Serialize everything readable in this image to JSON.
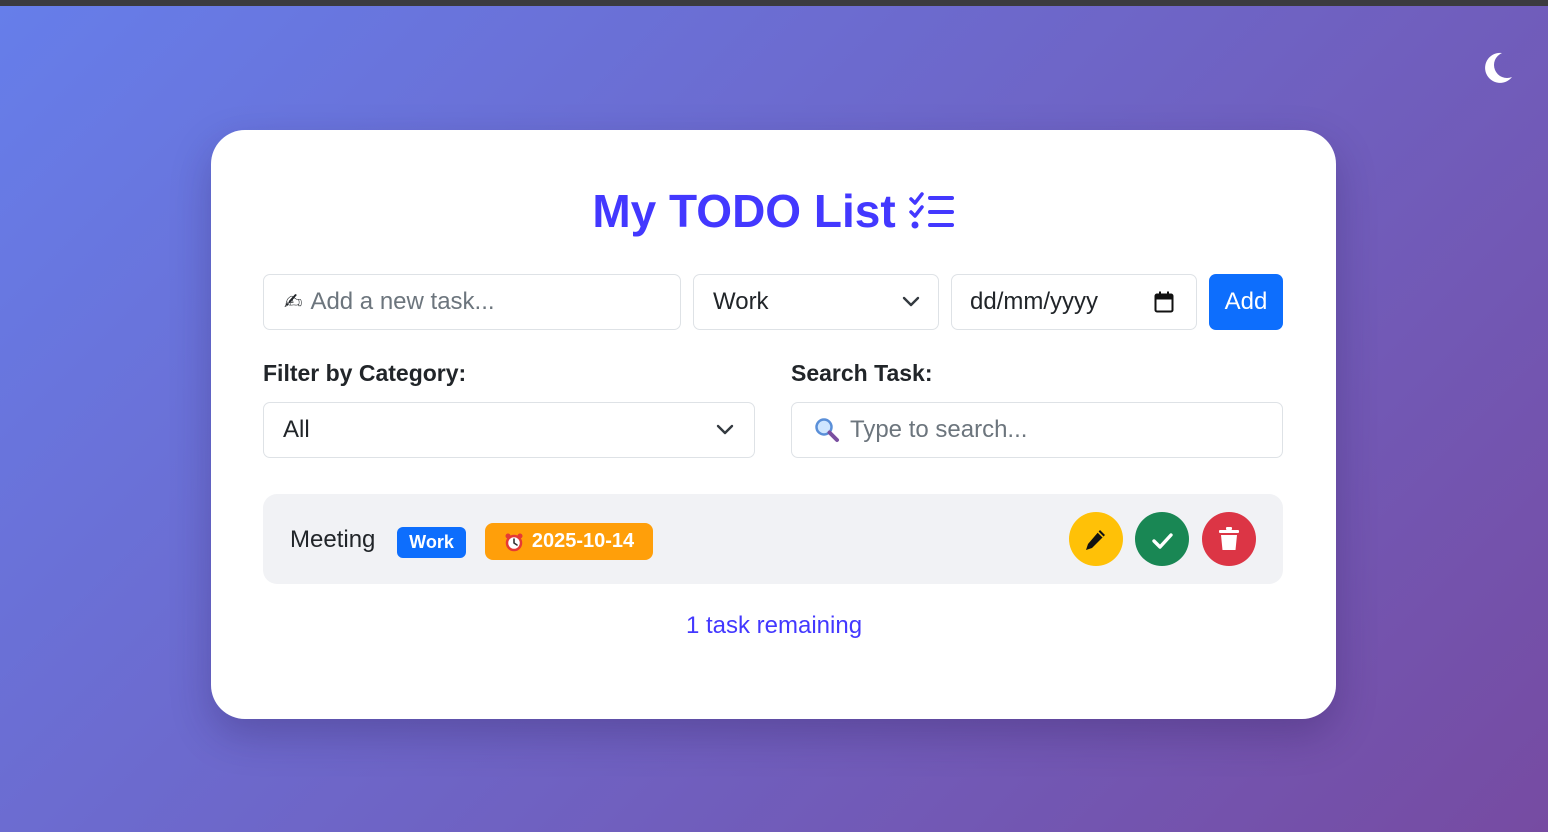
{
  "header": {
    "title": "My TODO List"
  },
  "theme_toggle": {
    "icon": "moon-icon"
  },
  "add_form": {
    "task_placeholder": "Add a new task...",
    "category_value": "Work",
    "date_placeholder": "dd/mm/yyyy",
    "add_label": "Add"
  },
  "filter": {
    "label": "Filter by Category:",
    "value": "All"
  },
  "search": {
    "label": "Search Task:",
    "placeholder": "Type to search..."
  },
  "tasks": [
    {
      "text": "Meeting",
      "category": "Work",
      "due": "2025-10-14"
    }
  ],
  "footer": {
    "remaining": "1 task remaining"
  },
  "colors": {
    "accent": "#4338ff",
    "primary": "#0d6efd",
    "warning": "#ffc107",
    "success": "#198754",
    "danger": "#dc3545",
    "due_badge": "#ff9f0a"
  }
}
